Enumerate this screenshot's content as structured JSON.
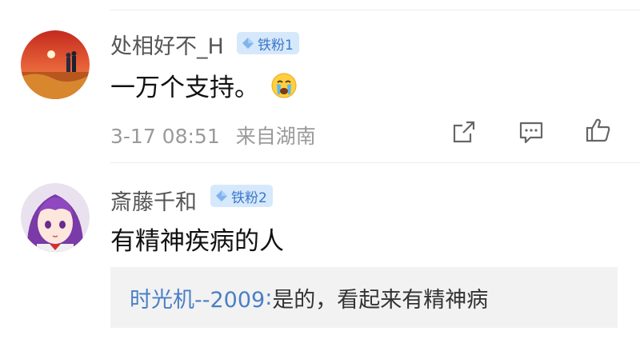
{
  "comments": [
    {
      "username": "处相好不_H",
      "badge": "铁粉1",
      "text": "一万个支持。",
      "emoji": "crying-face-emoji",
      "timestamp": "3-17 08:51",
      "location": "来自湖南"
    },
    {
      "username": "斎藤千和",
      "badge": "铁粉2",
      "text": "有精神疾病的人",
      "reply": {
        "user": "时光机--2009",
        "separator": ":",
        "text": " 是的，看起来有精神病"
      }
    }
  ],
  "icons": {
    "share": "share-icon",
    "comment": "comment-icon",
    "like": "thumbs-up-icon",
    "badge": "diamond-icon"
  },
  "colors": {
    "badge_bg": "#d6e8fb",
    "badge_text": "#3a78c9",
    "reply_user": "#4a7fc6",
    "meta": "#9a9a9a"
  }
}
